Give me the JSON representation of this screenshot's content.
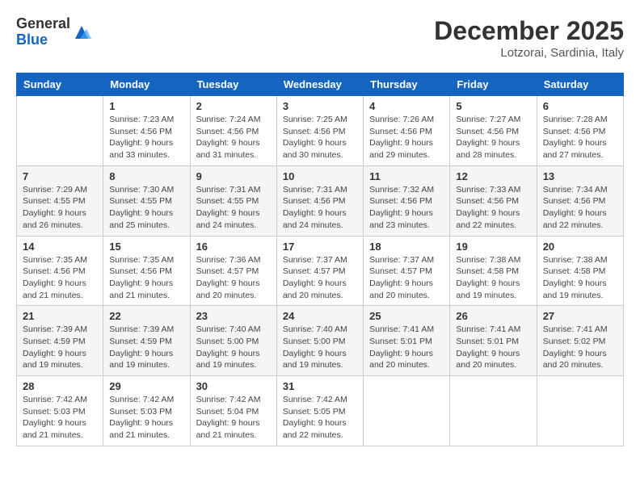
{
  "logo": {
    "general": "General",
    "blue": "Blue"
  },
  "header": {
    "month": "December 2025",
    "location": "Lotzorai, Sardinia, Italy"
  },
  "weekdays": [
    "Sunday",
    "Monday",
    "Tuesday",
    "Wednesday",
    "Thursday",
    "Friday",
    "Saturday"
  ],
  "weeks": [
    [
      {
        "day": "",
        "info": ""
      },
      {
        "day": "1",
        "info": "Sunrise: 7:23 AM\nSunset: 4:56 PM\nDaylight: 9 hours\nand 33 minutes."
      },
      {
        "day": "2",
        "info": "Sunrise: 7:24 AM\nSunset: 4:56 PM\nDaylight: 9 hours\nand 31 minutes."
      },
      {
        "day": "3",
        "info": "Sunrise: 7:25 AM\nSunset: 4:56 PM\nDaylight: 9 hours\nand 30 minutes."
      },
      {
        "day": "4",
        "info": "Sunrise: 7:26 AM\nSunset: 4:56 PM\nDaylight: 9 hours\nand 29 minutes."
      },
      {
        "day": "5",
        "info": "Sunrise: 7:27 AM\nSunset: 4:56 PM\nDaylight: 9 hours\nand 28 minutes."
      },
      {
        "day": "6",
        "info": "Sunrise: 7:28 AM\nSunset: 4:56 PM\nDaylight: 9 hours\nand 27 minutes."
      }
    ],
    [
      {
        "day": "7",
        "info": "Sunrise: 7:29 AM\nSunset: 4:55 PM\nDaylight: 9 hours\nand 26 minutes."
      },
      {
        "day": "8",
        "info": "Sunrise: 7:30 AM\nSunset: 4:55 PM\nDaylight: 9 hours\nand 25 minutes."
      },
      {
        "day": "9",
        "info": "Sunrise: 7:31 AM\nSunset: 4:55 PM\nDaylight: 9 hours\nand 24 minutes."
      },
      {
        "day": "10",
        "info": "Sunrise: 7:31 AM\nSunset: 4:56 PM\nDaylight: 9 hours\nand 24 minutes."
      },
      {
        "day": "11",
        "info": "Sunrise: 7:32 AM\nSunset: 4:56 PM\nDaylight: 9 hours\nand 23 minutes."
      },
      {
        "day": "12",
        "info": "Sunrise: 7:33 AM\nSunset: 4:56 PM\nDaylight: 9 hours\nand 22 minutes."
      },
      {
        "day": "13",
        "info": "Sunrise: 7:34 AM\nSunset: 4:56 PM\nDaylight: 9 hours\nand 22 minutes."
      }
    ],
    [
      {
        "day": "14",
        "info": "Sunrise: 7:35 AM\nSunset: 4:56 PM\nDaylight: 9 hours\nand 21 minutes."
      },
      {
        "day": "15",
        "info": "Sunrise: 7:35 AM\nSunset: 4:56 PM\nDaylight: 9 hours\nand 21 minutes."
      },
      {
        "day": "16",
        "info": "Sunrise: 7:36 AM\nSunset: 4:57 PM\nDaylight: 9 hours\nand 20 minutes."
      },
      {
        "day": "17",
        "info": "Sunrise: 7:37 AM\nSunset: 4:57 PM\nDaylight: 9 hours\nand 20 minutes."
      },
      {
        "day": "18",
        "info": "Sunrise: 7:37 AM\nSunset: 4:57 PM\nDaylight: 9 hours\nand 20 minutes."
      },
      {
        "day": "19",
        "info": "Sunrise: 7:38 AM\nSunset: 4:58 PM\nDaylight: 9 hours\nand 19 minutes."
      },
      {
        "day": "20",
        "info": "Sunrise: 7:38 AM\nSunset: 4:58 PM\nDaylight: 9 hours\nand 19 minutes."
      }
    ],
    [
      {
        "day": "21",
        "info": "Sunrise: 7:39 AM\nSunset: 4:59 PM\nDaylight: 9 hours\nand 19 minutes."
      },
      {
        "day": "22",
        "info": "Sunrise: 7:39 AM\nSunset: 4:59 PM\nDaylight: 9 hours\nand 19 minutes."
      },
      {
        "day": "23",
        "info": "Sunrise: 7:40 AM\nSunset: 5:00 PM\nDaylight: 9 hours\nand 19 minutes."
      },
      {
        "day": "24",
        "info": "Sunrise: 7:40 AM\nSunset: 5:00 PM\nDaylight: 9 hours\nand 19 minutes."
      },
      {
        "day": "25",
        "info": "Sunrise: 7:41 AM\nSunset: 5:01 PM\nDaylight: 9 hours\nand 20 minutes."
      },
      {
        "day": "26",
        "info": "Sunrise: 7:41 AM\nSunset: 5:01 PM\nDaylight: 9 hours\nand 20 minutes."
      },
      {
        "day": "27",
        "info": "Sunrise: 7:41 AM\nSunset: 5:02 PM\nDaylight: 9 hours\nand 20 minutes."
      }
    ],
    [
      {
        "day": "28",
        "info": "Sunrise: 7:42 AM\nSunset: 5:03 PM\nDaylight: 9 hours\nand 21 minutes."
      },
      {
        "day": "29",
        "info": "Sunrise: 7:42 AM\nSunset: 5:03 PM\nDaylight: 9 hours\nand 21 minutes."
      },
      {
        "day": "30",
        "info": "Sunrise: 7:42 AM\nSunset: 5:04 PM\nDaylight: 9 hours\nand 21 minutes."
      },
      {
        "day": "31",
        "info": "Sunrise: 7:42 AM\nSunset: 5:05 PM\nDaylight: 9 hours\nand 22 minutes."
      },
      {
        "day": "",
        "info": ""
      },
      {
        "day": "",
        "info": ""
      },
      {
        "day": "",
        "info": ""
      }
    ]
  ]
}
